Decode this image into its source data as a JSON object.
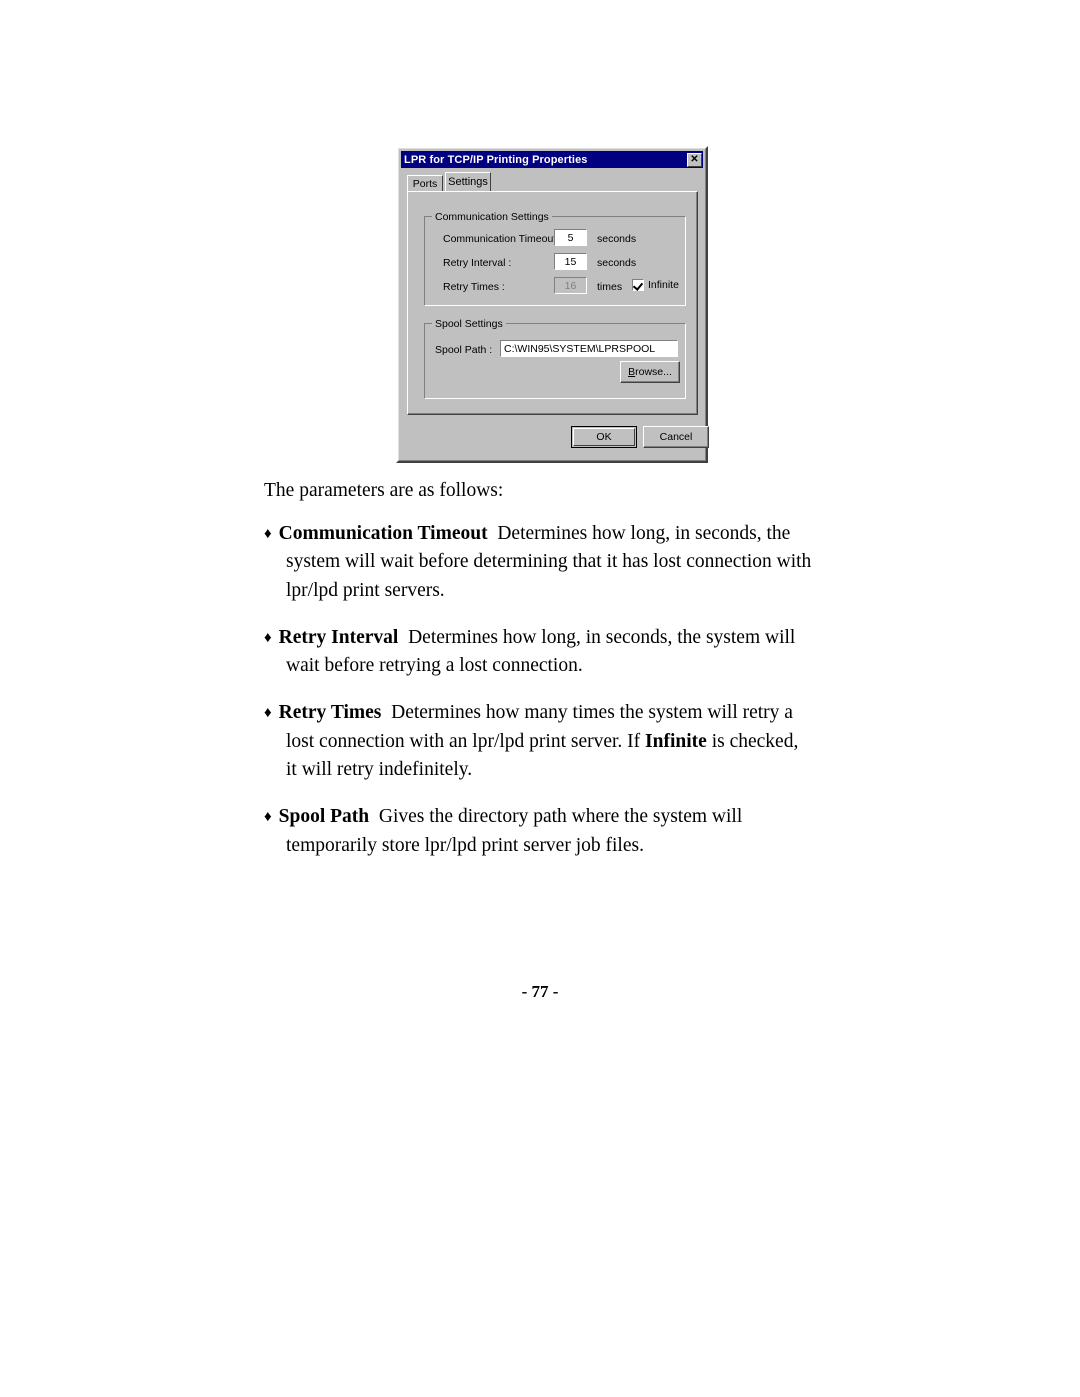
{
  "document": {
    "page_number": "- 77 -",
    "intro": "The parameters are as follows:",
    "bullets": [
      {
        "bullet": "♦",
        "term": "Communication Timeout",
        "description": "Determines how long, in seconds, the system will wait before determining that it has lost connection with lpr/lpd print servers."
      },
      {
        "bullet": "♦",
        "term": "Retry Interval",
        "description": "Determines how long, in seconds, the system will wait before retrying a lost connection."
      },
      {
        "bullet": "♦",
        "term": "Retry Times",
        "description_before": "Determines how many times the system will retry a lost connection with an lpr/lpd print server.   If ",
        "emphasis": "Infinite",
        "description_after": " is checked, it will retry indefinitely."
      },
      {
        "bullet": "♦",
        "term": "Spool Path",
        "description": "Gives the directory path where the system will temporarily store lpr/lpd print server job files."
      }
    ]
  },
  "dialog": {
    "title": "LPR for TCP/IP Printing Properties",
    "close_glyph": "✕",
    "titlebar_color": "#000080",
    "face_color": "#c0c0c0",
    "tabs": [
      {
        "label": "Ports",
        "active": false
      },
      {
        "label": "Settings",
        "active": true
      }
    ],
    "communication_settings": {
      "legend": "Communication Settings",
      "fields": [
        {
          "label": "Communication Timeout :",
          "value": "5",
          "unit": "seconds",
          "disabled": false
        },
        {
          "label": "Retry Interval :",
          "value": "15",
          "unit": "seconds",
          "disabled": false
        },
        {
          "label": "Retry Times :",
          "value": "16",
          "unit": "times",
          "disabled": true
        }
      ],
      "infinite_checkbox": {
        "label": "Infinite",
        "checked": true
      }
    },
    "spool_settings": {
      "legend": "Spool Settings",
      "path_label": "Spool Path :",
      "path_value": "C:\\WIN95\\SYSTEM\\LPRSPOOL",
      "browse_accel": "B",
      "browse_rest": "rowse..."
    },
    "buttons": {
      "ok": "OK",
      "cancel": "Cancel"
    }
  }
}
